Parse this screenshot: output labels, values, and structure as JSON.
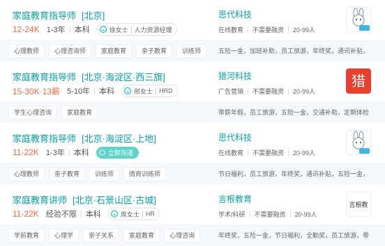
{
  "jobs": [
    {
      "title": "家庭教育指导师",
      "location": "[北京]",
      "salary": "12-24K",
      "experience": "1-3年",
      "education": "本科",
      "recruiter": {
        "name": "徐女士",
        "role": "人力资源经理"
      },
      "company": "思代科技",
      "company_meta": [
        "在线教育",
        "不需要融资",
        "20-99人"
      ],
      "tags": [
        "心理教师",
        "心理咨询师",
        "家庭教育",
        "亲子教育",
        "训练师"
      ],
      "welfare": "五险一金，加班补助，员工旅游，年终奖，通讯补贴，节...",
      "logo": {
        "type": "bunny",
        "text": "爱汁兔"
      }
    },
    {
      "title": "家庭教育指导师",
      "location": "[北京·海淀区·西三旗]",
      "salary": "15-30K·13薪",
      "experience": "5-10年",
      "education": "本科",
      "recruiter": {
        "name": "邢女士",
        "role": "HRD"
      },
      "company": "猎河科技",
      "company_meta": [
        "广告营销",
        "不需要融资",
        "20-99人"
      ],
      "tags": [
        "学生心理咨询",
        "家庭教育"
      ],
      "welfare": "带薪年假，员工旅游，五险一金，交通补助，定期体检，...",
      "logo": {
        "type": "lie",
        "text": "猎"
      }
    },
    {
      "title": "家庭教育指导师",
      "location": "[北京·海淀区·上地]",
      "salary": "11-22K",
      "experience": "1-3年",
      "education": "本科",
      "chat_label": "立即沟通",
      "company": "思代科技",
      "company_meta": [
        "在线教育",
        "不需要融资",
        "20-99人"
      ],
      "tags": [
        "心理教师",
        "亲子教育",
        "训练师",
        "情商训练师"
      ],
      "welfare": "节日福利，员工旅游，年终奖，通讯补贴，五险一金，加...",
      "logo": {
        "type": "bunny",
        "text": "爱汁兔"
      }
    },
    {
      "title": "家庭教育讲师",
      "location": "[北京·石景山区·古城]",
      "salary": "11-22K",
      "experience": "经验不限",
      "education": "本科",
      "recruiter": {
        "name": "席女士",
        "role": "HR"
      },
      "company": "言根教育",
      "company_meta": [
        "学术/科研",
        "不需要融资",
        "20-99人"
      ],
      "tags": [
        "学前教育",
        "心理学",
        "亲子关系",
        "家庭教育",
        "心理咨询"
      ],
      "welfare": "年终奖，五险一金，节日福利，全勤奖，员工旅游，带薪...",
      "logo": {
        "type": "yangen",
        "text": "言根教育"
      }
    }
  ],
  "colors": {
    "accent": "#00a6a7",
    "salary": "#ff6a3d",
    "chat": "#5dd5c8",
    "lie_logo": "#e8402c"
  }
}
